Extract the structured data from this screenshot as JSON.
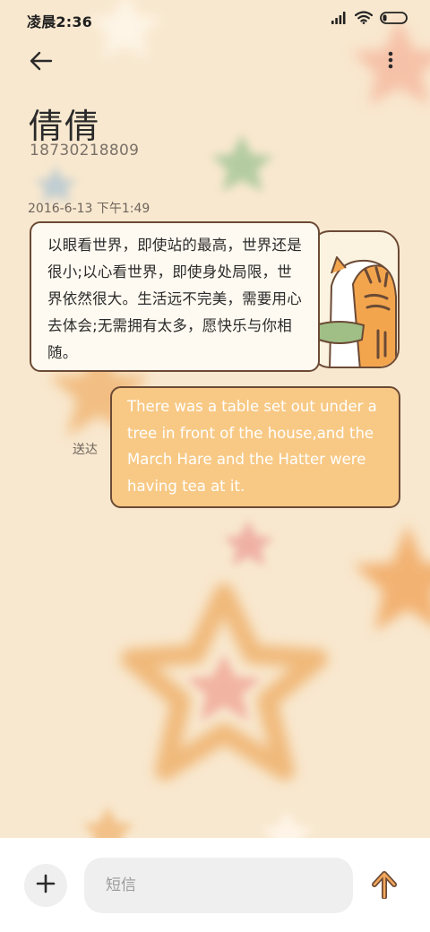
{
  "status_bar": {
    "time": "凌晨2:36",
    "icons": [
      "signal-icon",
      "wifi-icon",
      "battery-icon"
    ]
  },
  "header": {
    "back_icon": "arrow-left-icon",
    "more_icon": "more-vertical-icon",
    "contact_name": "倩倩",
    "contact_number": "18730218809"
  },
  "conversation": {
    "timestamp": "2016-6-13 下午1:49",
    "incoming_message": "以眼看世界，即使站的最高，世界还是很小;以心看世界，即使身处局限，世界依然很大。生活远不完美，需要用心去体会;无需拥有太多，愿快乐与你相随。",
    "outgoing_message": "There was a table set out under a tree in front of the house,and the March Hare and the Hatter were having tea at it.",
    "outgoing_status": "送达"
  },
  "composer": {
    "add_icon": "plus-icon",
    "input_placeholder": "短信",
    "input_value": "",
    "send_icon": "arrow-up-send-icon"
  },
  "theme": {
    "background": "#f8e8cf",
    "bubble_border": "#6b4a35",
    "incoming_bubble": "#fffaf1",
    "outgoing_bubble": "#f8c985",
    "accent_orange": "#f2a65a"
  }
}
